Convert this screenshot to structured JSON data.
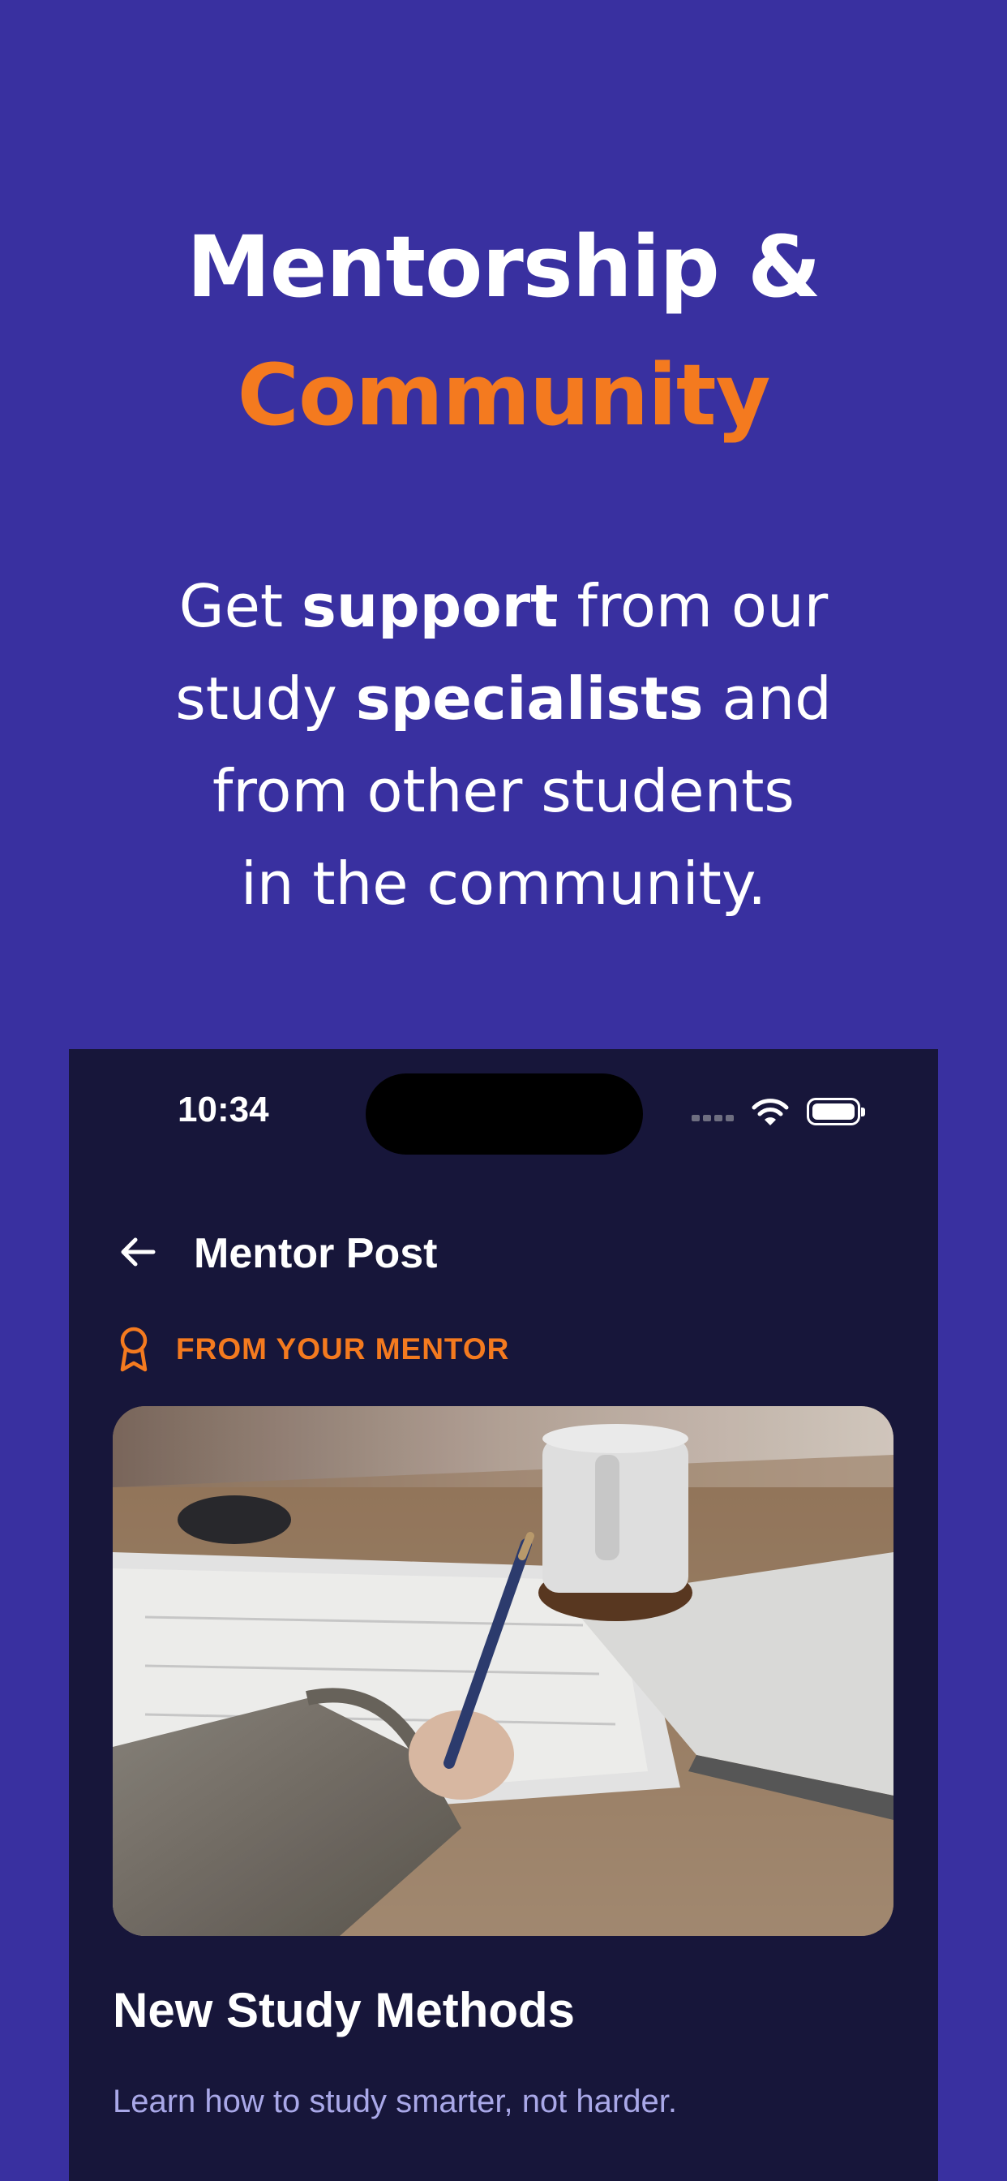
{
  "headline": {
    "line1": "Mentorship &",
    "line2": "Community"
  },
  "subtext": {
    "l1_a": "Get ",
    "l1_b": "support",
    "l1_c": " from our",
    "l2_a": "study ",
    "l2_b": "specialists",
    "l2_c": " and",
    "l3": "from other students",
    "l4": "in the community."
  },
  "phone": {
    "status": {
      "time": "10:34"
    },
    "nav": {
      "title": "Mentor Post"
    },
    "tag": {
      "label": "FROM YOUR MENTOR"
    },
    "post": {
      "title": "New Study Methods",
      "description": "Learn how to study smarter, not harder."
    }
  },
  "colors": {
    "background": "#3930A0",
    "accent": "#F47A1F",
    "phone_bg": "#17163A",
    "desc_text": "#A9A8E8"
  },
  "icons": {
    "back": "arrow-left-icon",
    "badge": "award-ribbon-icon",
    "wifi": "wifi-icon",
    "battery": "battery-icon",
    "signal": "signal-dots-icon"
  }
}
